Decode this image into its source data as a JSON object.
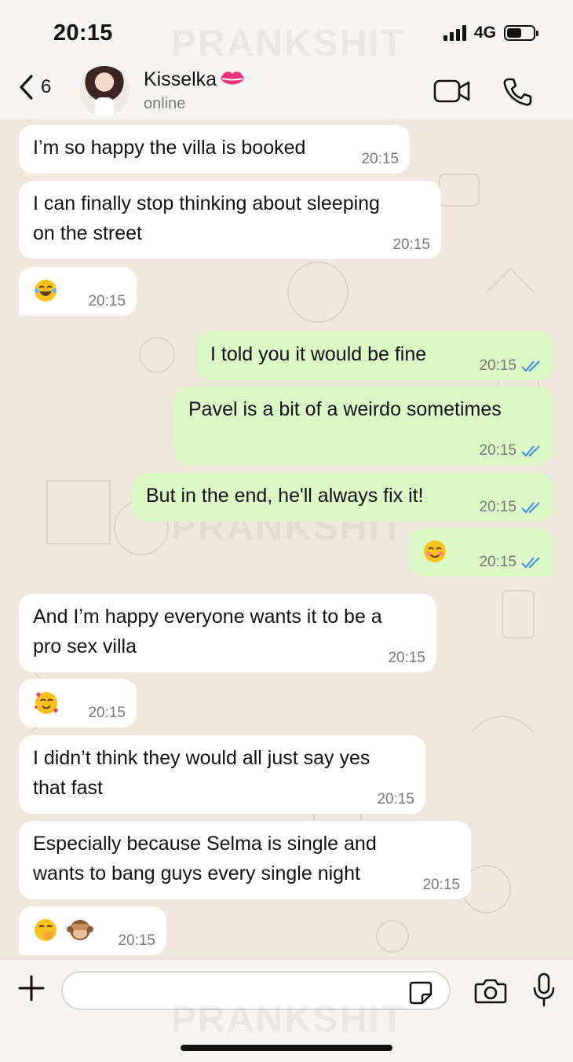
{
  "status_bar": {
    "time": "20:15",
    "network": "4G"
  },
  "watermark": "PRANKSHIT",
  "header": {
    "back_count": "6",
    "contact_name": "Kisselka",
    "contact_name_emoji": "kiss-mark-icon",
    "contact_status": "online"
  },
  "messages": [
    {
      "direction": "in",
      "text": "I’m so happy the villa is booked",
      "time": "20:15"
    },
    {
      "direction": "in",
      "lines": [
        "I can finally stop thinking about sleeping",
        "on the street"
      ],
      "time": "20:15"
    },
    {
      "direction": "in",
      "emoji": [
        "laughing-tears-emoji"
      ],
      "time": "20:15"
    },
    {
      "direction": "out",
      "text": "I told you it would be fine",
      "time": "20:15",
      "read": true
    },
    {
      "direction": "out",
      "text": "Pavel is a bit of a weirdo sometimes",
      "time": "20:15",
      "read": true
    },
    {
      "direction": "out",
      "text": "But in the end, he'll always fix it!",
      "time": "20:15",
      "read": true
    },
    {
      "direction": "out",
      "emoji": [
        "smiling-blush-emoji"
      ],
      "time": "20:15",
      "read": true
    },
    {
      "direction": "in",
      "lines": [
        "And I’m happy everyone wants it to be a",
        "pro sex villa"
      ],
      "time": "20:15"
    },
    {
      "direction": "in",
      "emoji": [
        "smiling-hearts-emoji"
      ],
      "time": "20:15"
    },
    {
      "direction": "in",
      "lines": [
        "I didn’t think they would all just say yes",
        "that fast"
      ],
      "time": "20:15"
    },
    {
      "direction": "in",
      "lines": [
        "Especially because Selma is single and",
        "wants to bang guys every single night"
      ],
      "time": "20:15"
    },
    {
      "direction": "in",
      "emoji": [
        "hand-over-mouth-emoji",
        "see-no-evil-monkey-emoji"
      ],
      "time": "20:15"
    }
  ],
  "input": {
    "placeholder": ""
  },
  "colors": {
    "incoming_bubble": "#ffffff",
    "outgoing_bubble": "#dbf8c6",
    "read_ticks": "#3a8ddc",
    "chat_background": "#efe8dd"
  }
}
